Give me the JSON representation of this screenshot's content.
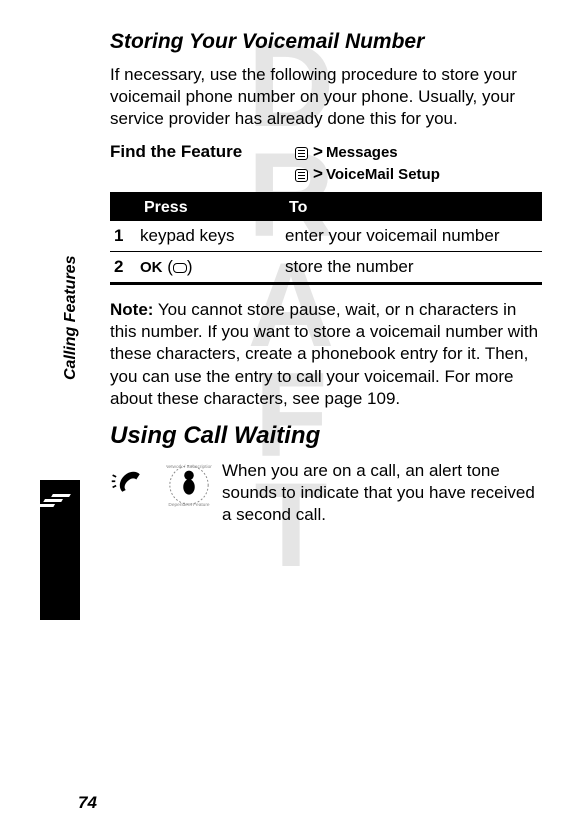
{
  "watermark": "DRAFT",
  "sidebar_label": "Calling Features",
  "page_number": "74",
  "section1": {
    "title": "Storing Your Voicemail Number",
    "intro": "If necessary, use the following procedure to store your voicemail phone number on your phone. Usually, your service provider has already done this for you.",
    "find_feature_label": "Find the Feature",
    "path1": "Messages",
    "path2": "VoiceMail Setup",
    "table": {
      "header_press": "Press",
      "header_to": "To",
      "row1": {
        "num": "1",
        "press": "keypad keys",
        "to": "enter your voicemail number"
      },
      "row2": {
        "num": "2",
        "press_label": "OK",
        "to": "store the number"
      }
    },
    "note_label": "Note:",
    "note_text": " You cannot store pause, wait, or n characters in this number. If you want to store a voicemail number with these characters, create a phonebook entry for it. Then, you can use the entry to call your voicemail. For more about these characters, see page 109."
  },
  "section2": {
    "title": "Using Call Waiting",
    "text": "When you are on a call, an alert tone sounds to indicate that you have received a second call."
  }
}
